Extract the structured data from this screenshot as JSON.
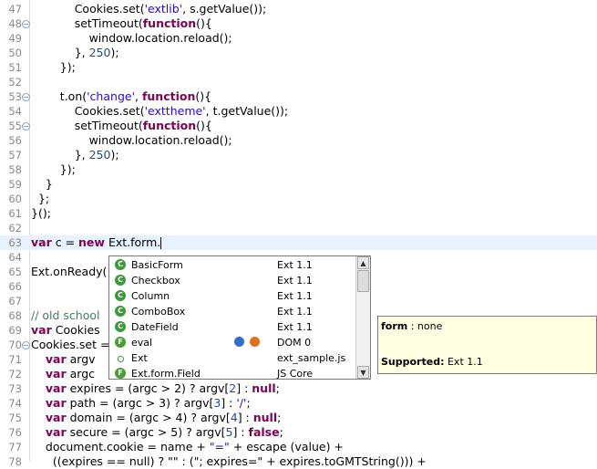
{
  "editor": {
    "lines": [
      {
        "n": "47",
        "fold": false,
        "segs": [
          [
            "sp",
            "            "
          ],
          [
            "t",
            "Cookies.set("
          ],
          [
            "str",
            "'extlib'"
          ],
          [
            "t",
            ", s.getValue());"
          ]
        ]
      },
      {
        "n": "48",
        "fold": true,
        "segs": [
          [
            "sp",
            "            "
          ],
          [
            "t",
            "setTimeout("
          ],
          [
            "kw",
            "function"
          ],
          [
            "t",
            "(){"
          ]
        ]
      },
      {
        "n": "49",
        "fold": false,
        "segs": [
          [
            "sp",
            "                "
          ],
          [
            "t",
            "window.location.reload();"
          ]
        ]
      },
      {
        "n": "50",
        "fold": false,
        "segs": [
          [
            "sp",
            "            "
          ],
          [
            "t",
            "}, "
          ],
          [
            "num",
            "250"
          ],
          [
            "t",
            ");"
          ]
        ]
      },
      {
        "n": "51",
        "fold": false,
        "segs": [
          [
            "sp",
            "        "
          ],
          [
            "t",
            "});"
          ]
        ]
      },
      {
        "n": "52",
        "fold": false,
        "segs": []
      },
      {
        "n": "53",
        "fold": true,
        "segs": [
          [
            "sp",
            "        "
          ],
          [
            "t",
            "t.on("
          ],
          [
            "str",
            "'change'"
          ],
          [
            "t",
            ", "
          ],
          [
            "kw",
            "function"
          ],
          [
            "t",
            "(){"
          ]
        ]
      },
      {
        "n": "54",
        "fold": false,
        "segs": [
          [
            "sp",
            "            "
          ],
          [
            "t",
            "Cookies.set("
          ],
          [
            "str",
            "'exttheme'"
          ],
          [
            "t",
            ", t.getValue());"
          ]
        ]
      },
      {
        "n": "55",
        "fold": true,
        "segs": [
          [
            "sp",
            "            "
          ],
          [
            "t",
            "setTimeout("
          ],
          [
            "kw",
            "function"
          ],
          [
            "t",
            "(){"
          ]
        ]
      },
      {
        "n": "56",
        "fold": false,
        "segs": [
          [
            "sp",
            "                "
          ],
          [
            "t",
            "window.location.reload();"
          ]
        ]
      },
      {
        "n": "57",
        "fold": false,
        "segs": [
          [
            "sp",
            "            "
          ],
          [
            "t",
            "}, "
          ],
          [
            "num",
            "250"
          ],
          [
            "t",
            ");"
          ]
        ]
      },
      {
        "n": "58",
        "fold": false,
        "segs": [
          [
            "sp",
            "        "
          ],
          [
            "t",
            "});"
          ]
        ]
      },
      {
        "n": "59",
        "fold": false,
        "segs": [
          [
            "sp",
            "    "
          ],
          [
            "t",
            "}"
          ]
        ]
      },
      {
        "n": "60",
        "fold": false,
        "segs": [
          [
            "sp",
            "  "
          ],
          [
            "t",
            "};"
          ]
        ]
      },
      {
        "n": "61",
        "fold": false,
        "segs": [
          [
            "t",
            "}();"
          ]
        ]
      },
      {
        "n": "62",
        "fold": false,
        "segs": []
      },
      {
        "n": "63",
        "fold": false,
        "current": true,
        "segs": [
          [
            "kw",
            "var"
          ],
          [
            "t",
            " c = "
          ],
          [
            "kw",
            "new"
          ],
          [
            "t",
            " Ext.form."
          ]
        ]
      },
      {
        "n": "64",
        "fold": false,
        "segs": []
      },
      {
        "n": "65",
        "fold": false,
        "segs": [
          [
            "t",
            "Ext.onReady("
          ]
        ]
      },
      {
        "n": "66",
        "fold": false,
        "segs": []
      },
      {
        "n": "67",
        "fold": false,
        "segs": []
      },
      {
        "n": "68",
        "fold": false,
        "segs": [
          [
            "cm",
            "// old school"
          ]
        ]
      },
      {
        "n": "69",
        "fold": false,
        "segs": [
          [
            "kw",
            "var"
          ],
          [
            "t",
            " Cookies"
          ]
        ]
      },
      {
        "n": "70",
        "fold": true,
        "segs": [
          [
            "t",
            "Cookies.set ="
          ]
        ]
      },
      {
        "n": "71",
        "fold": false,
        "segs": [
          [
            "sp",
            "    "
          ],
          [
            "kw",
            "var"
          ],
          [
            "t",
            " argv"
          ]
        ]
      },
      {
        "n": "72",
        "fold": false,
        "segs": [
          [
            "sp",
            "    "
          ],
          [
            "kw",
            "var"
          ],
          [
            "t",
            " argc"
          ]
        ]
      },
      {
        "n": "73",
        "fold": false,
        "segs": [
          [
            "sp",
            "    "
          ],
          [
            "kw",
            "var"
          ],
          [
            "t",
            " expires = (argc > 2) ? argv["
          ],
          [
            "num",
            "2"
          ],
          [
            "t",
            "] : "
          ],
          [
            "kw",
            "null"
          ],
          [
            "t",
            ";"
          ]
        ]
      },
      {
        "n": "74",
        "fold": false,
        "segs": [
          [
            "sp",
            "    "
          ],
          [
            "kw",
            "var"
          ],
          [
            "t",
            " path = (argc > 3) ? argv["
          ],
          [
            "num",
            "3"
          ],
          [
            "t",
            "] : "
          ],
          [
            "str",
            "'/'"
          ],
          [
            "t",
            ";"
          ]
        ]
      },
      {
        "n": "75",
        "fold": false,
        "segs": [
          [
            "sp",
            "    "
          ],
          [
            "kw",
            "var"
          ],
          [
            "t",
            " domain = (argc > 4) ? argv["
          ],
          [
            "num",
            "4"
          ],
          [
            "t",
            "] : "
          ],
          [
            "kw",
            "null"
          ],
          [
            "t",
            ";"
          ]
        ]
      },
      {
        "n": "76",
        "fold": false,
        "segs": [
          [
            "sp",
            "    "
          ],
          [
            "kw",
            "var"
          ],
          [
            "t",
            " secure = (argc > 5) ? argv["
          ],
          [
            "num",
            "5"
          ],
          [
            "t",
            "] : "
          ],
          [
            "kw",
            "false"
          ],
          [
            "t",
            ";"
          ]
        ]
      },
      {
        "n": "77",
        "fold": false,
        "segs": [
          [
            "sp",
            "    "
          ],
          [
            "t",
            "document.cookie = name + "
          ],
          [
            "str",
            "\"=\""
          ],
          [
            "t",
            " + escape (value) +"
          ]
        ]
      },
      {
        "n": "78",
        "fold": false,
        "segs": [
          [
            "sp",
            "      "
          ],
          [
            "t",
            "((expires == null) ? \"\" : (\"; expires=\" + expires.toGMTString())) +"
          ]
        ]
      }
    ]
  },
  "assist": {
    "proposals": [
      {
        "icon": "class",
        "name": "BasicForm",
        "source": "Ext 1.1",
        "browsers": false,
        "selected": false
      },
      {
        "icon": "class",
        "name": "Checkbox",
        "source": "Ext 1.1",
        "browsers": false,
        "selected": false
      },
      {
        "icon": "class",
        "name": "Column",
        "source": "Ext 1.1",
        "browsers": false,
        "selected": false
      },
      {
        "icon": "class",
        "name": "ComboBox",
        "source": "Ext 1.1",
        "browsers": false,
        "selected": false
      },
      {
        "icon": "class",
        "name": "DateField",
        "source": "Ext 1.1",
        "browsers": false,
        "selected": false
      },
      {
        "icon": "func",
        "name": "eval",
        "source": "DOM 0",
        "browsers": true,
        "selected": false
      },
      {
        "icon": "field",
        "name": "Ext",
        "source": "ext_sample.js",
        "browsers": false,
        "selected": false
      },
      {
        "icon": "func",
        "name": "Ext.form.Field",
        "source": "JS Core",
        "browsers": false,
        "selected": false
      }
    ],
    "scroll_up": "▲",
    "scroll_down": "▼",
    "class_glyph": "C",
    "func_glyph": "F",
    "ie_color": "#2f6fcf",
    "ff_color": "#e0701c"
  },
  "tooltip": {
    "name_label": "form",
    "name_value": " : none",
    "supported_label": "Supported:",
    "supported_value": " Ext 1.1"
  },
  "colors": {
    "keyword": "#7f0055",
    "string": "#2a00ff",
    "comment": "#3f7f5f",
    "current_line": "#e8f2fe",
    "tooltip_bg": "#ffffe1"
  }
}
